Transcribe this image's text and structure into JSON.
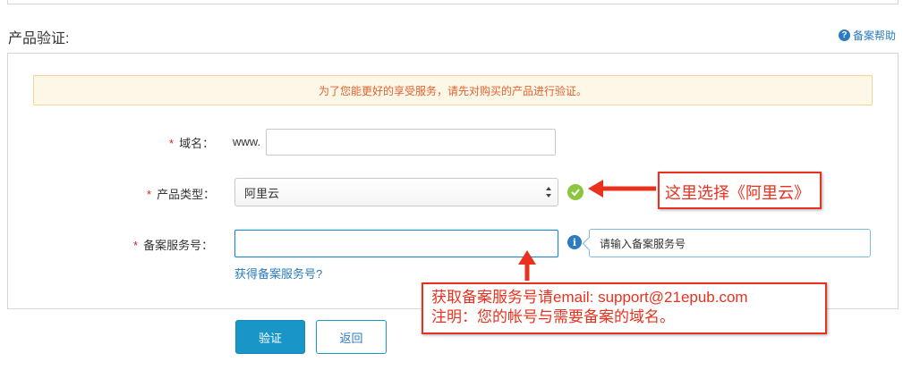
{
  "section_title": "产品验证:",
  "help_link": "备案帮助",
  "notice": "为了您能更好的享受服务，请先对购买的产品进行验证。",
  "form": {
    "domain": {
      "required_mark": "*",
      "label": "域名：",
      "prefix": "www.",
      "value": ""
    },
    "product_type": {
      "required_mark": "*",
      "label": "产品类型：",
      "selected": "阿里云"
    },
    "service_no": {
      "required_mark": "*",
      "label": "备案服务号：",
      "value": "",
      "tip": "请输入备案服务号",
      "link": "获得备案服务号?"
    }
  },
  "buttons": {
    "verify": "验证",
    "back": "返回"
  },
  "annotations": {
    "select_hint": "这里选择《阿里云》",
    "email_line1": "获取备案服务号请email: support@21epub.com",
    "email_line2": "注明：您的帐号与需要备案的域名。",
    "color": "#e8321f"
  },
  "icons": {
    "help": "question-circle-icon",
    "valid": "check-circle-icon",
    "info": "info-circle-icon"
  }
}
